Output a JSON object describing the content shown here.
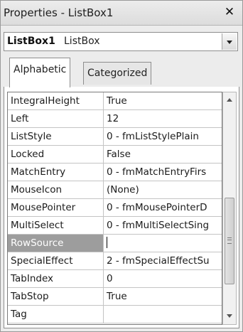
{
  "window": {
    "title": "Properties - ListBox1",
    "close_glyph": "✕"
  },
  "object_selector": {
    "name": "ListBox1",
    "type": "ListBox"
  },
  "tabs": [
    {
      "label": "Alphabetic",
      "active": true
    },
    {
      "label": "Categorized",
      "active": false
    }
  ],
  "properties": [
    {
      "name": "IntegralHeight",
      "value": "True"
    },
    {
      "name": "Left",
      "value": "12"
    },
    {
      "name": "ListStyle",
      "value": "0 - fmListStylePlain"
    },
    {
      "name": "Locked",
      "value": "False"
    },
    {
      "name": "MatchEntry",
      "value": "0 - fmMatchEntryFirs"
    },
    {
      "name": "MouseIcon",
      "value": "(None)"
    },
    {
      "name": "MousePointer",
      "value": "0 - fmMousePointerD"
    },
    {
      "name": "MultiSelect",
      "value": "0 - fmMultiSelectSing"
    },
    {
      "name": "RowSource",
      "value": ""
    },
    {
      "name": "SpecialEffect",
      "value": "2 - fmSpecialEffectSu"
    },
    {
      "name": "TabIndex",
      "value": "0"
    },
    {
      "name": "TabStop",
      "value": "True"
    },
    {
      "name": "Tag",
      "value": ""
    }
  ],
  "selected_property": "RowSource",
  "colors": {
    "selected_row": "#9d9d9d",
    "window_bg": "#ececec",
    "grid_line": "#c4c4c4"
  },
  "icons": {
    "close": "close-icon",
    "dropdown": "chevron-down-icon",
    "scroll_up": "arrow-up-icon",
    "scroll_down": "arrow-down-icon"
  }
}
